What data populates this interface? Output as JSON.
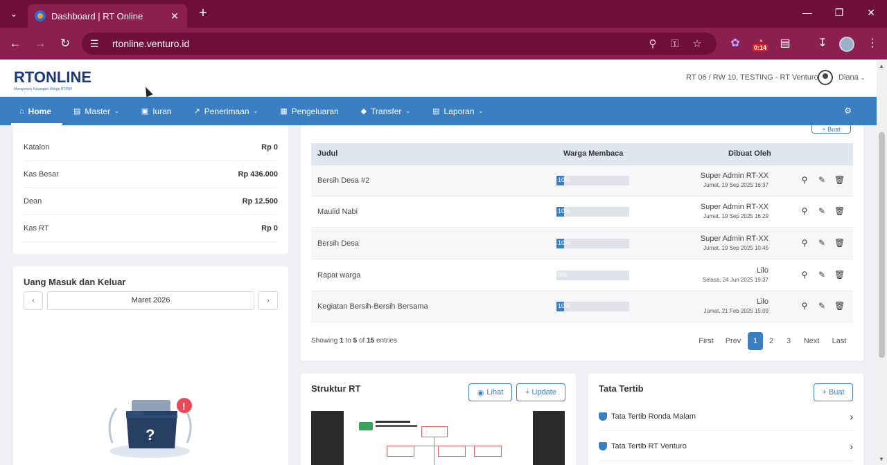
{
  "browser": {
    "tab_title": "Dashboard | RT Online",
    "url": "rtonline.venturo.id",
    "timer_badge": "0:14"
  },
  "app": {
    "logo_main": "RTONLINE",
    "logo_sub": "Manajemen Keuangan Warga RT/RW",
    "org": "RT 06 / RW 10, TESTING - RT Venturo",
    "user": "Diana"
  },
  "nav": {
    "items": [
      {
        "label": "Home",
        "icon": "home-icon"
      },
      {
        "label": "Master",
        "icon": "document-icon"
      },
      {
        "label": "Iuran",
        "icon": "card-icon"
      },
      {
        "label": "Penerimaan",
        "icon": "chart-icon"
      },
      {
        "label": "Pengeluaran",
        "icon": "calc-icon"
      },
      {
        "label": "Transfer",
        "icon": "tag-icon"
      },
      {
        "label": "Laporan",
        "icon": "file-icon"
      }
    ]
  },
  "kas": {
    "rows": [
      {
        "name": "Katalon",
        "value": "Rp 0"
      },
      {
        "name": "Kas Besar",
        "value": "Rp 436.000"
      },
      {
        "name": "Dean",
        "value": "Rp 12.500"
      },
      {
        "name": "Kas RT",
        "value": "Rp 0"
      }
    ]
  },
  "uang": {
    "title": "Uang Masuk dan Keluar",
    "month": "Maret 2026"
  },
  "pengumuman": {
    "add_label": "+ Buat",
    "headers": {
      "judul": "Judul",
      "warga": "Warga Membaca",
      "dibuat": "Dibuat Oleh"
    },
    "rows": [
      {
        "judul": "Bersih Desa #2",
        "pct": "10%",
        "fill": 0.1,
        "by": "Super Admin RT-XX",
        "date": "Jumat, 19 Sep 2025 16:37"
      },
      {
        "judul": "Maulid Nabi",
        "pct": "10%",
        "fill": 0.1,
        "by": "Super Admin RT-XX",
        "date": "Jumat, 19 Sep 2025 16:29"
      },
      {
        "judul": "Bersih Desa",
        "pct": "10%",
        "fill": 0.1,
        "by": "Super Admin RT-XX",
        "date": "Jumat, 19 Sep 2025 10:45"
      },
      {
        "judul": "Rapat warga",
        "pct": "0%",
        "fill": 0,
        "by": "Lilo",
        "date": "Selasa, 24 Jun 2025 19:37"
      },
      {
        "judul": "Kegiatan Bersih-Bersih Bersama",
        "pct": "10%",
        "fill": 0.1,
        "by": "Lilo",
        "date": "Jumat, 21 Feb 2025 15:09"
      }
    ],
    "info": {
      "prefix": "Showing",
      "from": "1",
      "to_word": "to",
      "to": "5",
      "of_word": "of",
      "total": "15",
      "suffix": "entries"
    },
    "pager": {
      "first": "First",
      "prev": "Prev",
      "p1": "1",
      "p2": "2",
      "p3": "3",
      "next": "Next",
      "last": "Last"
    }
  },
  "struktur": {
    "title": "Struktur RT",
    "lihat": "Lihat",
    "update": "+ Update"
  },
  "tatatertib": {
    "title": "Tata Tertib",
    "buat": "+ Buat",
    "items": [
      "Tata Tertib Ronda Malam",
      "Tata Tertib RT Venturo"
    ]
  }
}
